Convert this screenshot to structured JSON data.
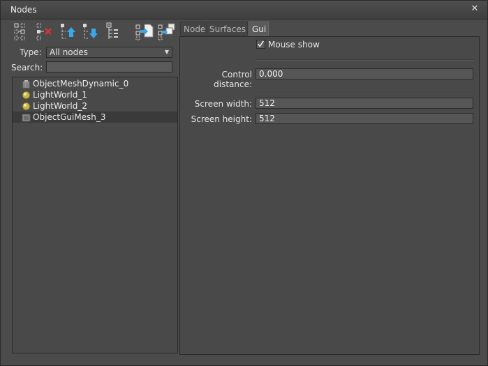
{
  "window": {
    "title": "Nodes",
    "close_icon": "close-icon"
  },
  "toolbar": {
    "buttons": [
      {
        "name": "add-node-button",
        "icon": "add-node-icon"
      },
      {
        "name": "remove-node-button",
        "icon": "remove-node-icon"
      },
      {
        "name": "move-up-button",
        "icon": "move-up-icon"
      },
      {
        "name": "move-down-button",
        "icon": "move-down-icon"
      },
      {
        "name": "expand-tree-button",
        "icon": "tree-list-icon"
      },
      {
        "name": "import-node-button",
        "icon": "import-node-icon"
      },
      {
        "name": "clone-node-button",
        "icon": "clone-node-icon"
      }
    ]
  },
  "filter": {
    "type_label": "Type:",
    "type_value": "All nodes",
    "search_label": "Search:",
    "search_value": ""
  },
  "tree": {
    "items": [
      {
        "label": "ObjectMeshDynamic_0",
        "icon": "mesh-dynamic-icon",
        "selected": false
      },
      {
        "label": "LightWorld_1",
        "icon": "light-icon",
        "selected": false
      },
      {
        "label": "LightWorld_2",
        "icon": "light-icon",
        "selected": false
      },
      {
        "label": "ObjectGuiMesh_3",
        "icon": "gui-mesh-icon",
        "selected": true
      }
    ]
  },
  "tabs": [
    {
      "label": "Node",
      "active": false
    },
    {
      "label": "Surfaces",
      "active": false
    },
    {
      "label": "Gui",
      "active": true
    }
  ],
  "gui": {
    "mouse_show_label": "Mouse show",
    "mouse_show_checked": true,
    "control_distance_label": "Control distance:",
    "control_distance_value": "0.000",
    "screen_width_label": "Screen width:",
    "screen_width_value": "512",
    "screen_height_label": "Screen height:",
    "screen_height_value": "512"
  }
}
